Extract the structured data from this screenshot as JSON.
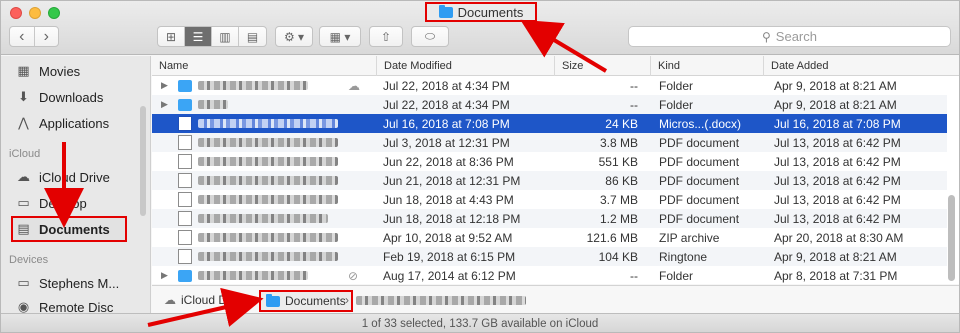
{
  "window": {
    "title": "Documents"
  },
  "toolbar": {
    "back": "‹",
    "forward": "›",
    "view_icons": "⊞",
    "view_list": "☰",
    "view_columns": "▥",
    "view_gallery": "▤",
    "action": "⚙ ▾",
    "arrange": "▦ ▾",
    "share": "⇧",
    "tag": "⬭",
    "search_placeholder": "Search"
  },
  "sidebar": {
    "items": [
      {
        "label": "Movies",
        "icon": "▦"
      },
      {
        "label": "Downloads",
        "icon": "⬇"
      },
      {
        "label": "Applications",
        "icon": "⋀"
      }
    ],
    "icloud_header": "iCloud",
    "icloud_items": [
      {
        "label": "iCloud Drive",
        "icon": "☁"
      },
      {
        "label": "Desktop",
        "icon": "▭"
      },
      {
        "label": "Documents",
        "icon": "▤"
      }
    ],
    "devices_header": "Devices",
    "device_items": [
      {
        "label": "Stephens M...",
        "icon": "▭"
      },
      {
        "label": "Remote Disc",
        "icon": "◉"
      }
    ]
  },
  "columns": {
    "name": "Name",
    "modified": "Date Modified",
    "size": "Size",
    "kind": "Kind",
    "added": "Date Added"
  },
  "rows": [
    {
      "modified": "Jul 22, 2018 at 4:34 PM",
      "size": "--",
      "kind": "Folder",
      "added": "Apr 9, 2018 at 8:21 AM"
    },
    {
      "modified": "Jul 22, 2018 at 4:34 PM",
      "size": "--",
      "kind": "Folder",
      "added": "Apr 9, 2018 at 8:21 AM"
    },
    {
      "modified": "Jul 16, 2018 at 7:08 PM",
      "size": "24 KB",
      "kind": "Micros...(.docx)",
      "added": "Jul 16, 2018 at 7:08 PM"
    },
    {
      "modified": "Jul 3, 2018 at 12:31 PM",
      "size": "3.8 MB",
      "kind": "PDF document",
      "added": "Jul 13, 2018 at 6:42 PM"
    },
    {
      "modified": "Jun 22, 2018 at 8:36 PM",
      "size": "551 KB",
      "kind": "PDF document",
      "added": "Jul 13, 2018 at 6:42 PM"
    },
    {
      "modified": "Jun 21, 2018 at 12:31 PM",
      "size": "86 KB",
      "kind": "PDF document",
      "added": "Jul 13, 2018 at 6:42 PM"
    },
    {
      "modified": "Jun 18, 2018 at 4:43 PM",
      "size": "3.7 MB",
      "kind": "PDF document",
      "added": "Jul 13, 2018 at 6:42 PM"
    },
    {
      "modified": "Jun 18, 2018 at 12:18 PM",
      "size": "1.2 MB",
      "kind": "PDF document",
      "added": "Jul 13, 2018 at 6:42 PM"
    },
    {
      "modified": "Apr 10, 2018 at 9:52 AM",
      "size": "121.6 MB",
      "kind": "ZIP archive",
      "added": "Apr 20, 2018 at 8:30 AM"
    },
    {
      "modified": "Feb 19, 2018 at 6:15 PM",
      "size": "104 KB",
      "kind": "Ringtone",
      "added": "Apr 9, 2018 at 8:21 AM"
    },
    {
      "modified": "Aug 17, 2014 at 6:12 PM",
      "size": "--",
      "kind": "Folder",
      "added": "Apr 8, 2018 at 7:31 PM"
    }
  ],
  "pathbar": {
    "root": "iCloud Drive",
    "current": "Documents",
    "sep": "›"
  },
  "status": "1 of 33 selected, 133.7 GB available on iCloud",
  "colors": {
    "selection": "#1e56c8",
    "highlight": "#e30000",
    "folder": "#3ba5f5"
  }
}
